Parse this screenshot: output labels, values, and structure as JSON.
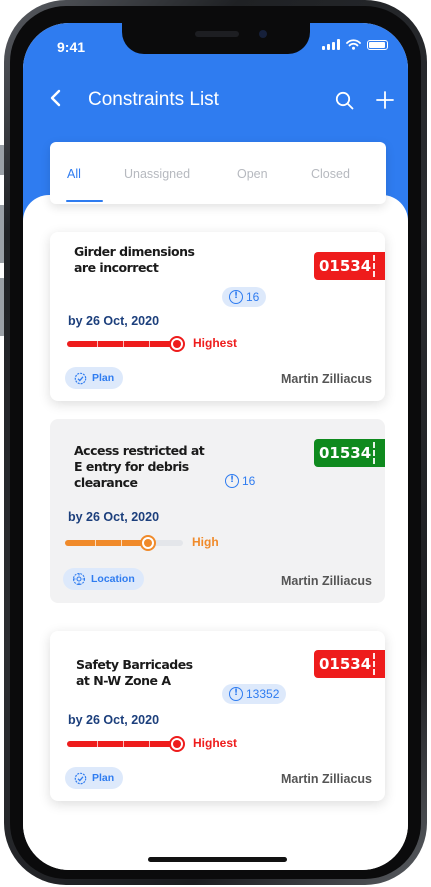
{
  "status_bar": {
    "time": "9:41"
  },
  "header": {
    "title": "Constraints List",
    "back_icon": "chevron-left-icon",
    "search_icon": "search-icon",
    "add_icon": "plus-icon",
    "color": "#2f7cf0"
  },
  "tabs": [
    {
      "label": "All",
      "active": true
    },
    {
      "label": "Unassigned",
      "active": false
    },
    {
      "label": "Open",
      "active": false
    },
    {
      "label": "Closed",
      "active": false
    }
  ],
  "cards": [
    {
      "title": "Girder dimensions are incorrect",
      "id": "01534",
      "id_color": "#ee1c1c",
      "count": "16",
      "due": "by 26 Oct, 2020",
      "priority": "Highest",
      "priority_color": "#ee1c1c",
      "priority_level": 1.0,
      "tag": "Plan",
      "tag_icon": "plan-icon",
      "assignee": "Martin Zilliacus"
    },
    {
      "title": "Access restricted at E entry for debris clearance",
      "id": "01534",
      "id_color": "#0f8a1e",
      "count": "16",
      "due": "by 26 Oct, 2020",
      "priority": "High",
      "priority_color": "#f08a2a",
      "priority_level": 0.72,
      "tag": "Location",
      "tag_icon": "location-icon",
      "assignee": "Martin Zilliacus"
    },
    {
      "title": "Safety Barricades at N-W Zone A",
      "id": "01534",
      "id_color": "#ee1c1c",
      "count": "13352",
      "due": "by 26 Oct, 2020",
      "priority": "Highest",
      "priority_color": "#ee1c1c",
      "priority_level": 1.0,
      "tag": "Plan",
      "tag_icon": "plan-icon",
      "assignee": "Martin Zilliacus"
    }
  ]
}
